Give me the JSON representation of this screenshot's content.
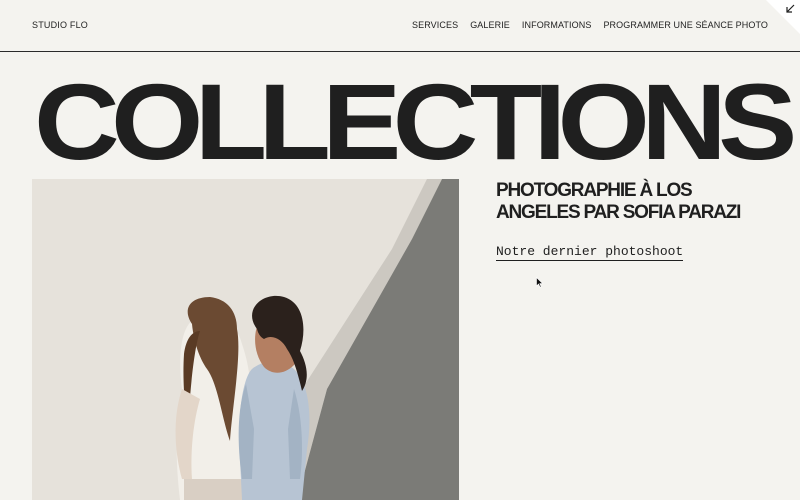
{
  "header": {
    "brand": "STUDIO FLO",
    "nav": [
      {
        "label": "SERVICES"
      },
      {
        "label": "GALERIE"
      },
      {
        "label": "INFORMATIONS"
      },
      {
        "label": "PROGRAMMER UNE SÉANCE PHOTO"
      }
    ],
    "corner_icon": "arrow-down-left-icon"
  },
  "hero": {
    "title": "COLLECTIONS"
  },
  "feature": {
    "photo_icon": "photo-two-women-back-to-back",
    "headline_line1": "PHOTOGRAPHIE À LOS",
    "headline_line2": "ANGELES PAR SOFIA PARAZI",
    "cta_label": "Notre dernier photoshoot"
  },
  "colors": {
    "background": "#f4f3ef",
    "text": "#1f1f1f",
    "divider": "#2a2a2a",
    "photo_wall": "#e5e1da",
    "photo_shadow": "#7a7a76"
  }
}
